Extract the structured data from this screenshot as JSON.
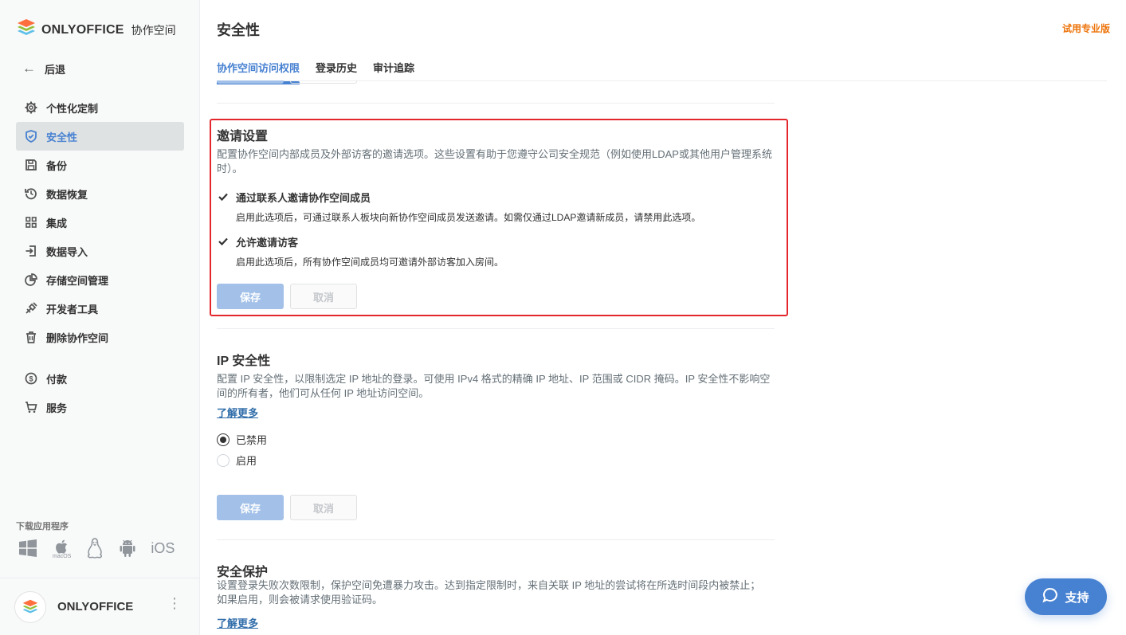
{
  "app": {
    "logo_text": "ONLYOFFICE",
    "logo_sub": "协作空间"
  },
  "sidebar": {
    "back_label": "后退",
    "items": [
      {
        "label": "个性化定制",
        "icon": "gear-icon"
      },
      {
        "label": "安全性",
        "icon": "shield-icon",
        "active": true
      },
      {
        "label": "备份",
        "icon": "save-icon"
      },
      {
        "label": "数据恢复",
        "icon": "restore-icon"
      },
      {
        "label": "集成",
        "icon": "grid-icon"
      },
      {
        "label": "数据导入",
        "icon": "import-icon"
      },
      {
        "label": "存储空间管理",
        "icon": "pie-chart-icon"
      },
      {
        "label": "开发者工具",
        "icon": "developer-tools-icon"
      },
      {
        "label": "删除协作空间",
        "icon": "trash-icon"
      }
    ],
    "items2": [
      {
        "label": "付款",
        "icon": "dollar-icon"
      },
      {
        "label": "服务",
        "icon": "cart-icon"
      }
    ],
    "download_label": "下载应用程序",
    "download_apps": [
      "windows-icon",
      "macos-icon",
      "linux-icon",
      "android-icon",
      "ios-icon"
    ],
    "macos_label": "macOS",
    "ios_label": "iOS",
    "footer_name": "ONLYOFFICE"
  },
  "header": {
    "title": "安全性",
    "trial_link": "试用专业版"
  },
  "tabs": [
    {
      "label": "协作空间访问权限",
      "active": true
    },
    {
      "label": "登录历史"
    },
    {
      "label": "审计追踪"
    }
  ],
  "invitation": {
    "title": "邀请设置",
    "description": "配置协作空间内部成员及外部访客的邀请选项。这些设置有助于您遵守公司安全规范（例如使用LDAP或其他用户管理系统时）。",
    "options": [
      {
        "label": "通过联系人邀请协作空间成员",
        "description": "启用此选项后，可通过联系人板块向新协作空间成员发送邀请。如需仅通过LDAP邀请新成员，请禁用此选项。",
        "checked": true
      },
      {
        "label": "允许邀请访客",
        "description": "启用此选项后，所有协作空间成员均可邀请外部访客加入房间。",
        "checked": true
      }
    ],
    "save_label": "保存",
    "cancel_label": "取消"
  },
  "ip_security": {
    "title": "IP 安全性",
    "description": "配置 IP 安全性，以限制选定 IP 地址的登录。可使用 IPv4 格式的精确 IP 地址、IP 范围或 CIDR 掩码。IP 安全性不影响空间的所有者，他们可从任何 IP 地址访问空间。",
    "learn_more": "了解更多",
    "options": [
      {
        "label": "已禁用",
        "checked": true
      },
      {
        "label": "启用",
        "checked": false
      }
    ],
    "save_label": "保存",
    "cancel_label": "取消"
  },
  "brute_force": {
    "title": "安全保护",
    "description": "设置登录失败次数限制，保护空间免遭暴力攻击。达到指定限制时，来自关联 IP 地址的尝试将在所选时间段内被禁止；如果启用，则会被请求使用验证码。",
    "learn_more": "了解更多"
  },
  "support_label": "支持",
  "colors": {
    "accent": "#4781d1",
    "trial": "#ed7309",
    "highlight": "#e3272c",
    "primary_disabled": "#a2c0e8"
  }
}
